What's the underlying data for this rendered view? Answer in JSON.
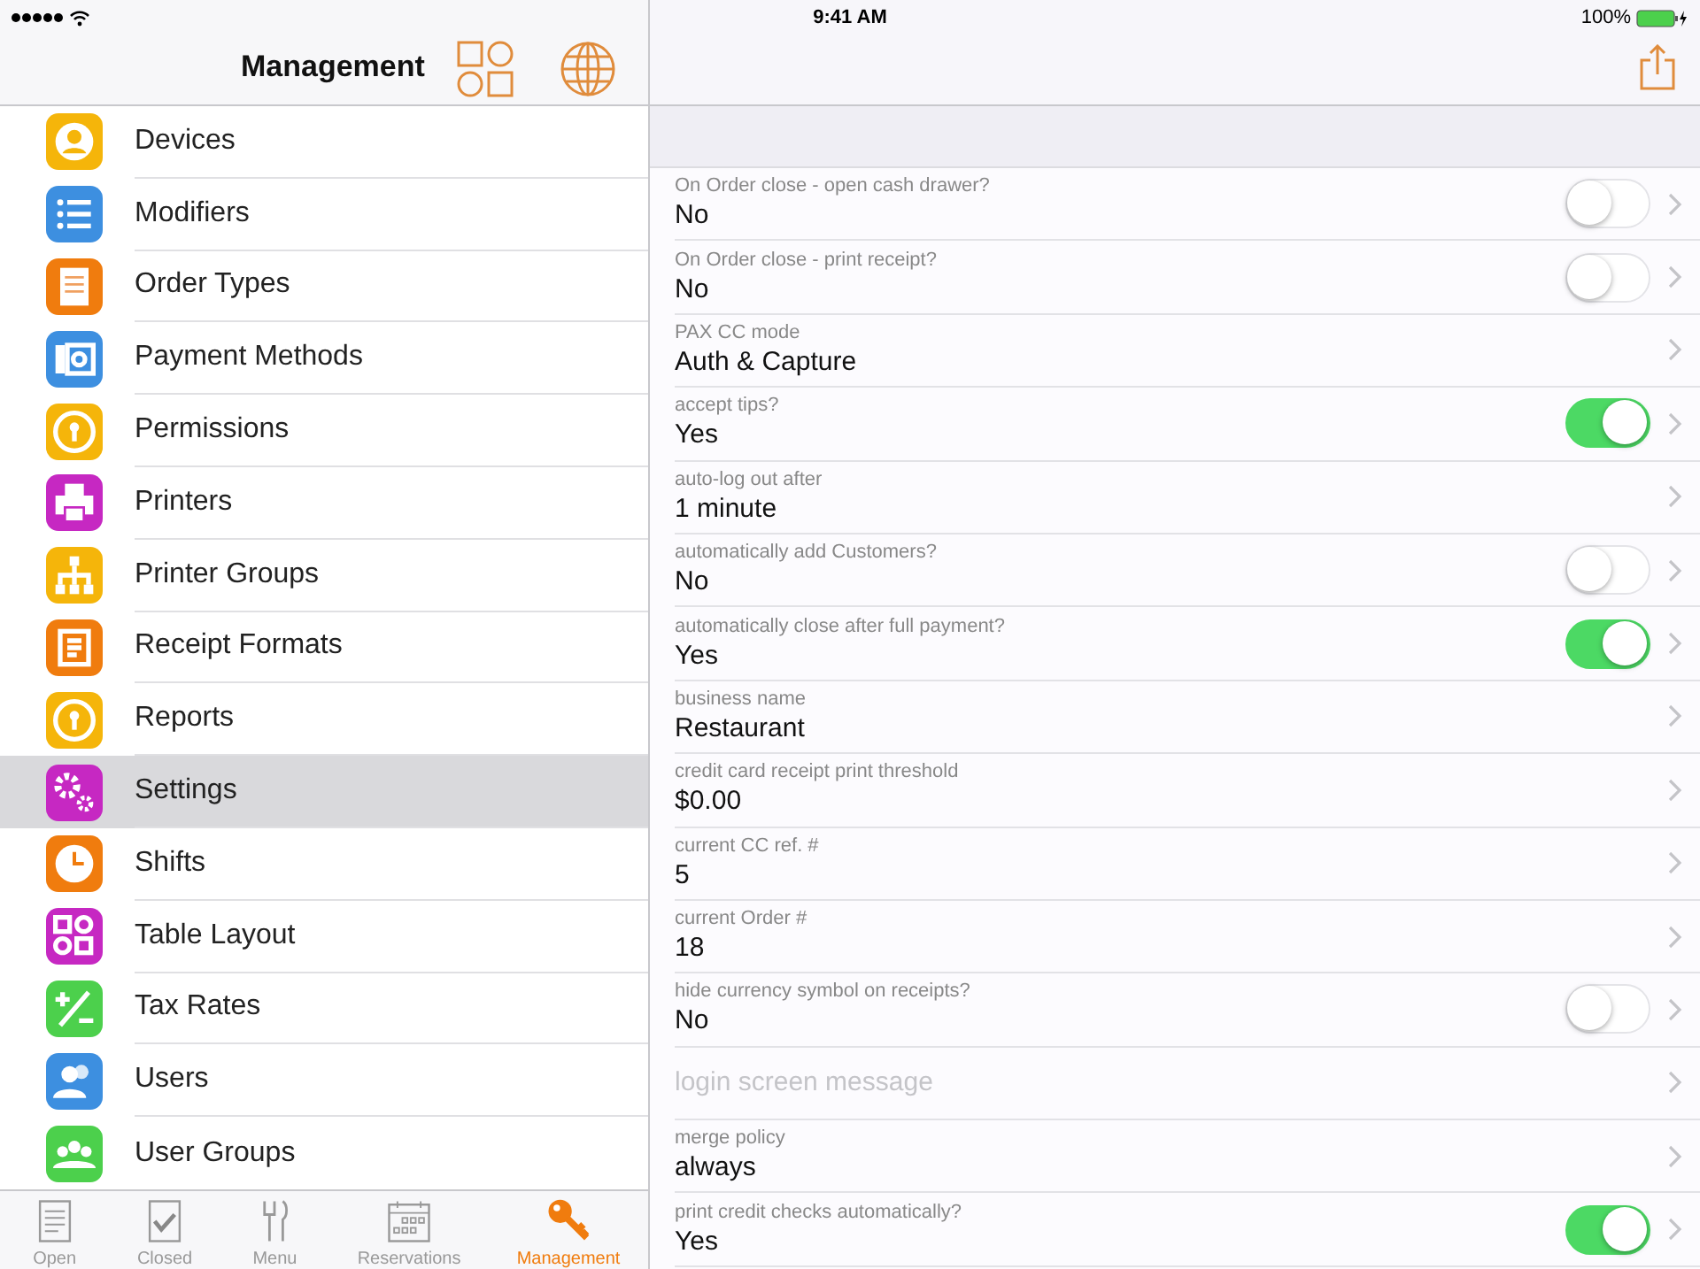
{
  "status_bar": {
    "time": "9:41 AM",
    "battery": "100%"
  },
  "sidebar": {
    "title": "Management",
    "items": [
      {
        "label": "Devices",
        "color": "#f5b50a",
        "selected": false
      },
      {
        "label": "Modifiers",
        "color": "#3d8fe0",
        "selected": false
      },
      {
        "label": "Order Types",
        "color": "#f07c0e",
        "selected": false
      },
      {
        "label": "Payment Methods",
        "color": "#3d8fe0",
        "selected": false
      },
      {
        "label": "Permissions",
        "color": "#f5b50a",
        "selected": false
      },
      {
        "label": "Printers",
        "color": "#c628c2",
        "selected": false
      },
      {
        "label": "Printer Groups",
        "color": "#f5b50a",
        "selected": false
      },
      {
        "label": "Receipt Formats",
        "color": "#f07c0e",
        "selected": false
      },
      {
        "label": "Reports",
        "color": "#f5b50a",
        "selected": false
      },
      {
        "label": "Settings",
        "color": "#c628c2",
        "selected": true
      },
      {
        "label": "Shifts",
        "color": "#f07c0e",
        "selected": false
      },
      {
        "label": "Table Layout",
        "color": "#c628c2",
        "selected": false
      },
      {
        "label": "Tax Rates",
        "color": "#4cd04c",
        "selected": false
      },
      {
        "label": "Users",
        "color": "#3d8fe0",
        "selected": false
      },
      {
        "label": "User Groups",
        "color": "#4cd04c",
        "selected": false
      }
    ]
  },
  "tab_bar": [
    {
      "label": "Open",
      "selected": false
    },
    {
      "label": "Closed",
      "selected": false
    },
    {
      "label": "Menu",
      "selected": false
    },
    {
      "label": "Reservations",
      "selected": false
    },
    {
      "label": "Management",
      "selected": true
    }
  ],
  "settings": [
    {
      "kind": "toggle",
      "label": "On Order close - open cash drawer?",
      "value": "No",
      "on": false
    },
    {
      "kind": "toggle",
      "label": "On Order close - print receipt?",
      "value": "No",
      "on": false
    },
    {
      "kind": "value",
      "label": "PAX CC mode",
      "value": "Auth & Capture"
    },
    {
      "kind": "toggle",
      "label": "accept tips?",
      "value": "Yes",
      "on": true
    },
    {
      "kind": "value",
      "label": "auto-log out after",
      "value": "1 minute"
    },
    {
      "kind": "toggle",
      "label": "automatically add Customers?",
      "value": "No",
      "on": false
    },
    {
      "kind": "toggle",
      "label": "automatically close after full payment?",
      "value": "Yes",
      "on": true
    },
    {
      "kind": "value",
      "label": "business name",
      "value": "Restaurant"
    },
    {
      "kind": "value",
      "label": "credit card receipt print threshold",
      "value": "$0.00"
    },
    {
      "kind": "value",
      "label": "current CC ref. #",
      "value": "5"
    },
    {
      "kind": "value",
      "label": "current Order #",
      "value": "18"
    },
    {
      "kind": "toggle",
      "label": "hide currency symbol on receipts?",
      "value": "No",
      "on": false
    },
    {
      "kind": "empty",
      "placeholder": "login screen message"
    },
    {
      "kind": "value",
      "label": "merge policy",
      "value": "always"
    },
    {
      "kind": "toggle",
      "label": "print credit checks automatically?",
      "value": "Yes",
      "on": true
    }
  ]
}
